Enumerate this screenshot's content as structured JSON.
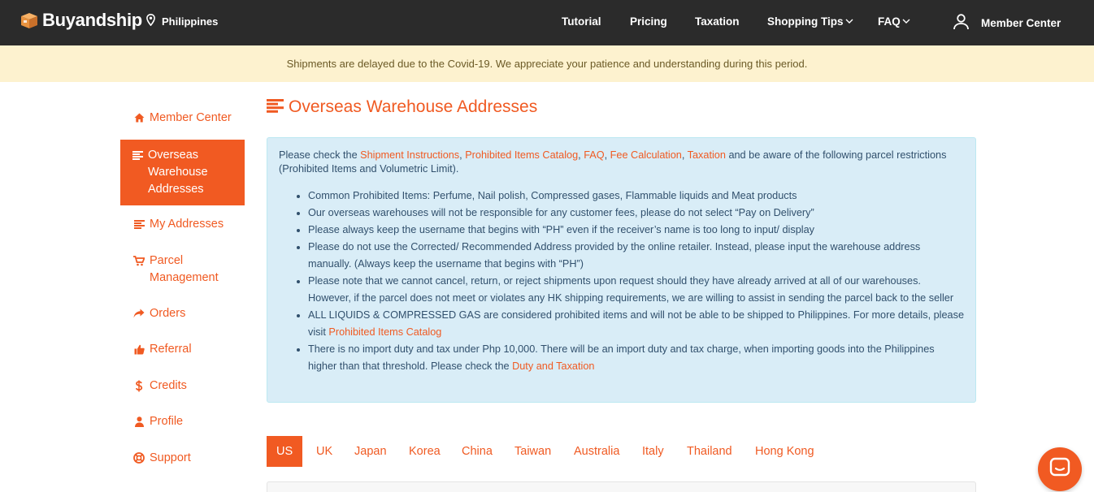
{
  "header": {
    "brand": "Buyandship",
    "location": "Philippines",
    "nav": [
      {
        "label": "Tutorial"
      },
      {
        "label": "Pricing"
      },
      {
        "label": "Taxation"
      },
      {
        "label": "Shopping Tips"
      },
      {
        "label": "FAQ"
      }
    ],
    "member_center": "Member Center",
    "icons": {
      "logo": "box-icon",
      "location": "map-pin-icon",
      "member": "user-icon",
      "dropdown": "chevron-down-icon"
    }
  },
  "banner": {
    "text": "Shipments are delayed due to the Covid-19. We appreciate your patience and understanding during this period."
  },
  "sidebar": {
    "items": [
      {
        "label": "Member Center",
        "icon": "home-icon"
      },
      {
        "label": "Overseas Warehouse Addresses",
        "icon": "list-icon",
        "active": true
      },
      {
        "label": "My Addresses",
        "icon": "list-icon"
      },
      {
        "label": "Parcel Management",
        "icon": "cart-icon"
      },
      {
        "label": "Orders",
        "icon": "share-arrow-icon"
      },
      {
        "label": "Referral",
        "icon": "thumbs-up-icon"
      },
      {
        "label": "Credits",
        "icon": "dollar-icon"
      },
      {
        "label": "Profile",
        "icon": "user-icon"
      },
      {
        "label": "Support",
        "icon": "lifebuoy-icon"
      }
    ]
  },
  "main": {
    "title": "Overseas Warehouse Addresses",
    "notice": {
      "intro_prefix": "Please check the ",
      "links": [
        "Shipment Instructions",
        "Prohibited Items Catalog",
        "FAQ",
        "Fee Calculation",
        "Taxation"
      ],
      "sep_comma": ", ",
      "intro_suffix": " and be aware of the following parcel restrictions (Prohibited Items and Volumetric Limit).",
      "bullets": [
        "Common Prohibited Items: Perfume, Nail polish, Compressed gases, Flammable liquids and Meat products",
        "Our overseas warehouses will not be responsible for any customer fees, please do not select “Pay on Delivery”",
        "Please always keep the username that begins with “PH” even if the receiver’s name is too long to input/ display",
        "Please do not use the Corrected/ Recommended Address provided by the online retailer. Instead, please input the warehouse address manually. (Always keep the username that begins with “PH”)",
        "Please note that we cannot cancel, return, or reject shipments upon request should they have already arrived at all of our warehouses. However, if the parcel does not meet or violates any HK shipping requirements, we are willing to assist in sending the parcel back to the seller"
      ],
      "bullet_liquids": "ALL LIQUIDS & COMPRESSED GAS are considered prohibited items and will not be able to be shipped to Philippines. For more details, please visit ",
      "bullet_liquids_link": "Prohibited Items Catalog",
      "bullet_duty": "There is no import duty and tax under Php 10,000. There will be an import duty and tax charge, when importing goods into the Philippines higher than that threshold. Please check the ",
      "bullet_duty_link": "Duty and Taxation"
    },
    "tabs": [
      "US",
      "UK",
      "Japan",
      "Korea",
      "China",
      "Taiwan",
      "Australia",
      "Italy",
      "Thailand",
      "Hong Kong"
    ],
    "active_tab": "US"
  },
  "colors": {
    "accent": "#f15a22",
    "topbar": "#2b2b2b",
    "banner_bg": "#fdf2cf",
    "notice_bg": "#d9edf7"
  },
  "chat": {
    "icon": "chat-icon"
  }
}
